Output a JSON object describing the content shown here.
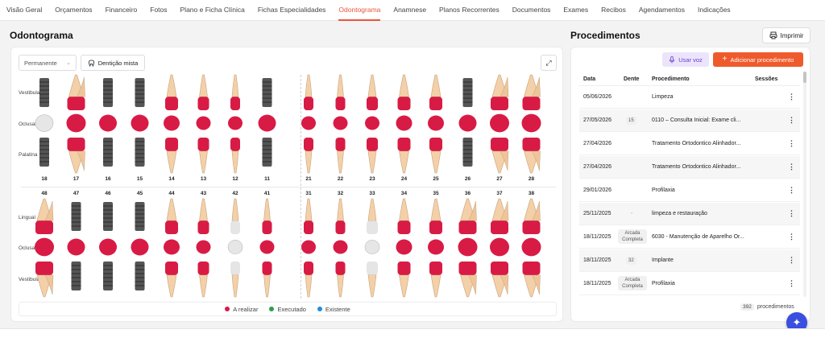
{
  "nav": {
    "tabs": [
      "Visão Geral",
      "Orçamentos",
      "Financeiro",
      "Fotos",
      "Plano e Ficha Clínica",
      "Fichas Especialidades",
      "Odontograma",
      "Anamnese",
      "Planos Recorrentes",
      "Documentos",
      "Exames",
      "Recibos",
      "Agendamentos",
      "Indicações"
    ],
    "active_index": 6
  },
  "odontograma": {
    "title": "Odontograma",
    "select_value": "Permanente",
    "mixed_button": "Dentição mista",
    "upper_labels": [
      "Vestibular",
      "Oclusal",
      "Palatina"
    ],
    "lower_labels": [
      "Lingual",
      "Oclusal",
      "Vestibular"
    ],
    "upper_numbers": [
      "18",
      "17",
      "16",
      "15",
      "14",
      "13",
      "12",
      "11",
      "21",
      "22",
      "23",
      "24",
      "25",
      "26",
      "27",
      "28"
    ],
    "lower_numbers": [
      "48",
      "47",
      "46",
      "45",
      "44",
      "43",
      "42",
      "41",
      "31",
      "32",
      "33",
      "34",
      "35",
      "36",
      "37",
      "38"
    ],
    "upper_types": [
      "implant",
      "molar",
      "implant",
      "implant",
      "premolar",
      "canine",
      "incisor",
      "implant",
      "incisor",
      "incisor",
      "canine",
      "premolar",
      "premolar",
      "implant",
      "molar",
      "molar"
    ],
    "lower_types": [
      "molar",
      "implant",
      "implant",
      "implant",
      "premolar",
      "canine",
      "incisor",
      "incisor",
      "incisor",
      "incisor",
      "canine",
      "premolar",
      "premolar",
      "molar",
      "molar",
      "molar"
    ],
    "upper_occlusal_state": [
      "existing",
      "red",
      "red",
      "red",
      "red",
      "red",
      "red",
      "red",
      "red",
      "red",
      "red",
      "red",
      "red",
      "red",
      "red",
      "red"
    ],
    "lower_occlusal_state": [
      "red",
      "red",
      "red",
      "red",
      "red",
      "red",
      "existing",
      "red",
      "red",
      "red",
      "existing",
      "red",
      "red",
      "red",
      "red",
      "red"
    ],
    "legend": [
      {
        "label": "A realizar",
        "color": "#d81b45"
      },
      {
        "label": "Executado",
        "color": "#2e9d4a"
      },
      {
        "label": "Existente",
        "color": "#1e90d8"
      }
    ]
  },
  "colors": {
    "accent": "#e8553a",
    "plan": "#d81b45",
    "enamel": "#f3d0a8",
    "implant": "#555555"
  },
  "procedimentos": {
    "title": "Procedimentos",
    "print_label": "Imprimir",
    "voice_label": "Usar voz",
    "add_label": "Adicionar procedimento",
    "columns": [
      "Data",
      "Dente",
      "Procedimento",
      "Sessões"
    ],
    "rows": [
      {
        "date": "05/06/2026",
        "tooth": "",
        "proc": "Limpeza"
      },
      {
        "date": "27/05/2026",
        "tooth": "15",
        "proc": "0110 – Consulta Inicial: Exame cli..."
      },
      {
        "date": "27/04/2026",
        "tooth": "",
        "proc": "Tratamento Ortodontico Alinhador..."
      },
      {
        "date": "27/04/2026",
        "tooth": "",
        "proc": "Tratamento Ortodontico Alinhador..."
      },
      {
        "date": "29/01/2026",
        "tooth": "",
        "proc": "Profilaxia"
      },
      {
        "date": "25/11/2025",
        "tooth": "-",
        "proc": "limpeza e restauração"
      },
      {
        "date": "18/11/2025",
        "tooth": "Arcada Completa",
        "proc": "6030 - Manutenção de Aparelho Or..."
      },
      {
        "date": "18/11/2025",
        "tooth": "32",
        "proc": "Implante"
      },
      {
        "date": "18/11/2025",
        "tooth": "Arcada Completa",
        "proc": "Profilaxia"
      }
    ],
    "count": "392",
    "count_label": "procedimentos"
  }
}
